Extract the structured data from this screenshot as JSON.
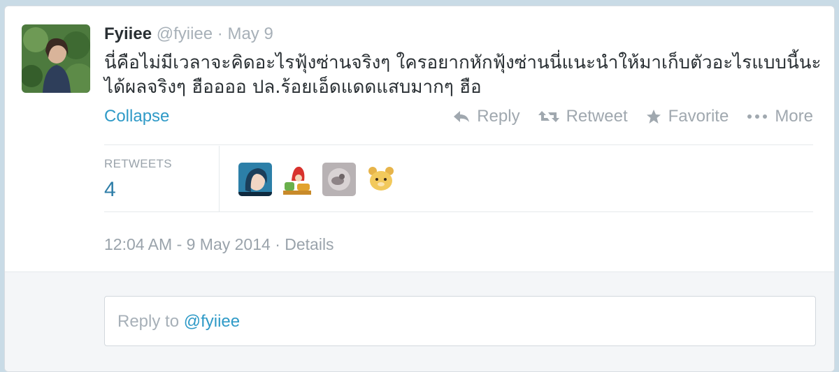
{
  "tweet": {
    "name": "Fyiiee",
    "handle": "@fyiiee",
    "separator": "·",
    "date": "May 9",
    "text_line1": "นี่คือไม่มีเวลาจะคิดอะไรฟุ้งซ่านจริงๆ ใครอยากหักฟุ้งซ่านนี่แนะนำให้มาเก็บตัวอะไรแบบนี้นะ",
    "text_line2": "ได้ผลจริงๆ ฮืออออ ปล.ร้อยเอ็ดแดดแสบมากๆ ฮือ",
    "collapse": "Collapse",
    "actions": {
      "reply": "Reply",
      "retweet": "Retweet",
      "favorite": "Favorite",
      "more": "More"
    },
    "retweets_label": "RETWEETS",
    "retweets_count": "4",
    "retweeter_icons": [
      "avatar-blue-character",
      "avatar-red-hood-character",
      "avatar-gray-photo",
      "avatar-yellow-bear"
    ],
    "timestamp": "12:04 AM - 9 May 2014 · Details"
  },
  "reply": {
    "prefix": "Reply to ",
    "mention": "@fyiiee"
  },
  "colors": {
    "link": "#2f9ac7",
    "muted": "#a0a8af",
    "text": "#292f33"
  }
}
